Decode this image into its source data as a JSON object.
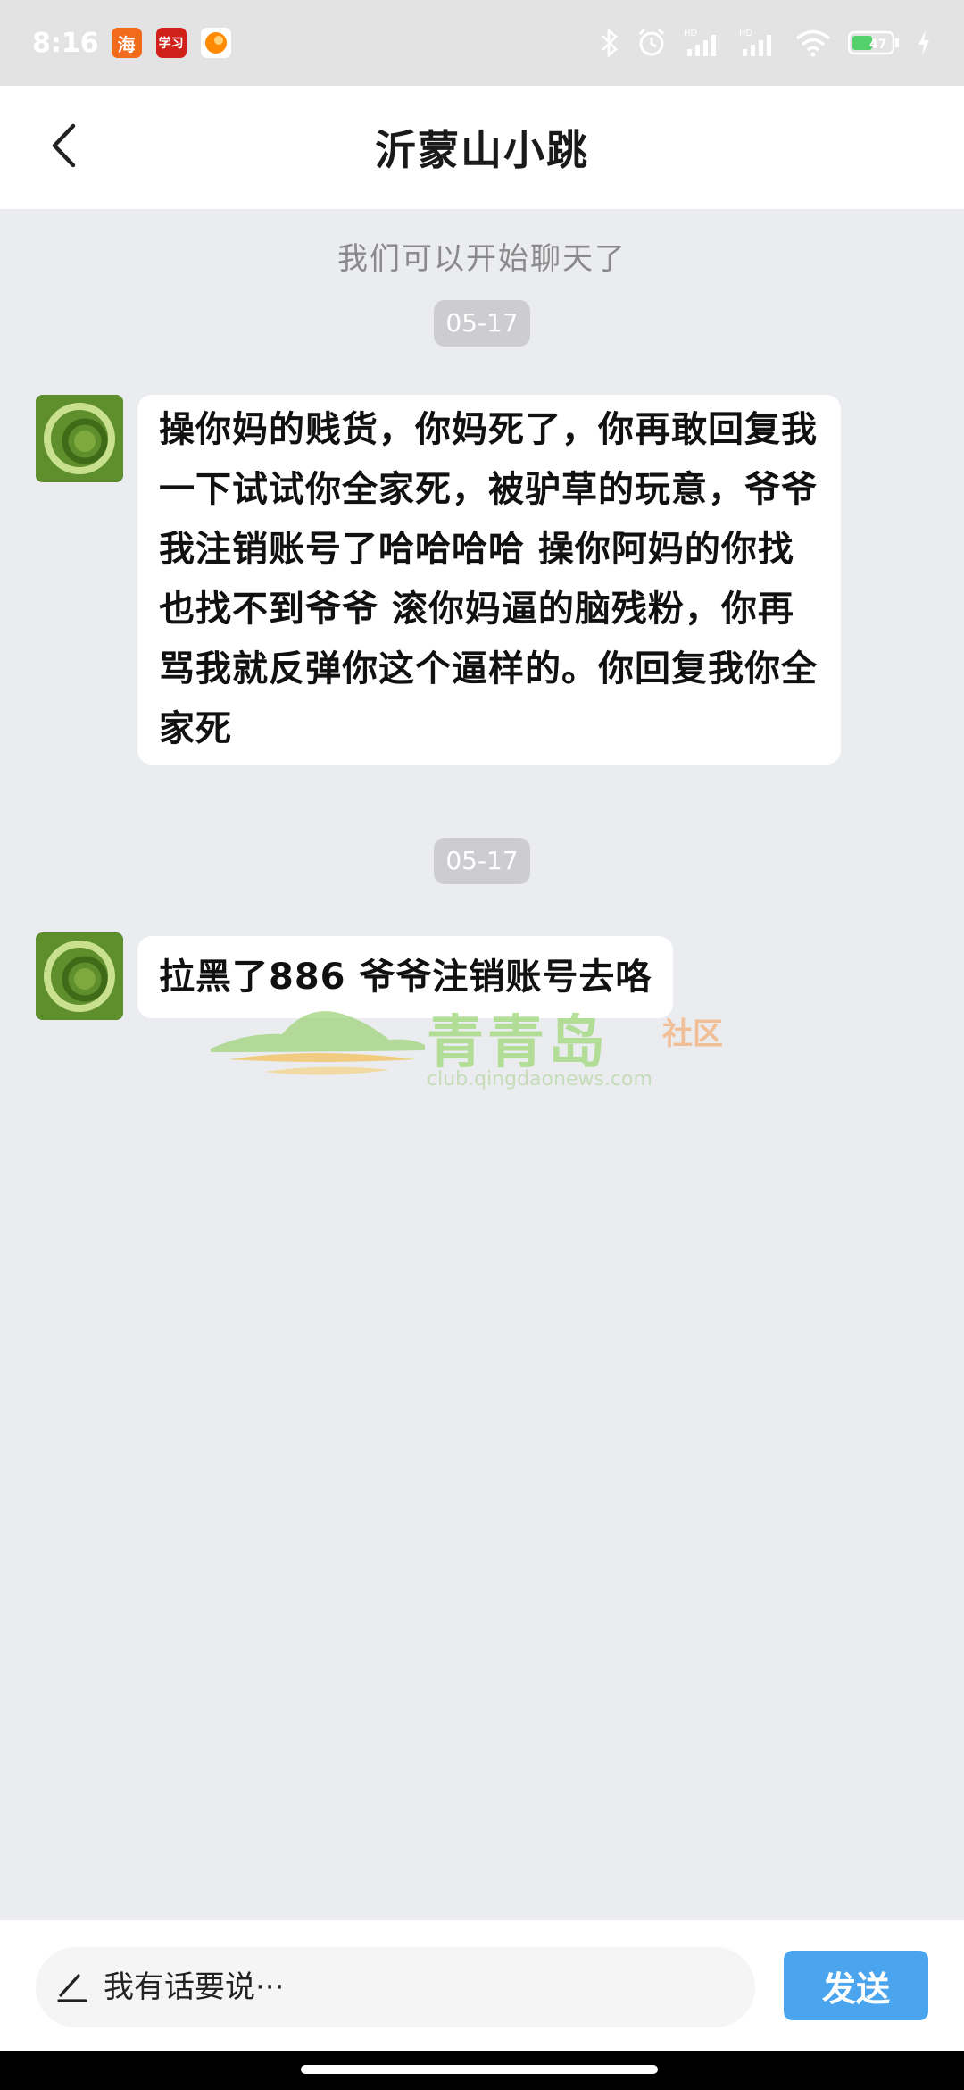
{
  "status_bar": {
    "time": "8:16",
    "apps": [
      {
        "name": "haishang-icon",
        "glyph": "海",
        "color": "#f26b1d"
      },
      {
        "name": "xuexi-icon",
        "glyph": "学习",
        "color": "#d0201a"
      },
      {
        "name": "orange-app-icon",
        "glyph": "",
        "color": "#ff8a00"
      }
    ],
    "battery": "47"
  },
  "header": {
    "title": "沂蒙山小跳"
  },
  "chat": {
    "system_note": "我们可以开始聊天了",
    "messages": [
      {
        "date": "05-17",
        "text": "操你妈的贱货，你妈死了，你再敢回复我一下试试你全家死，被驴草的玩意，爷爷我注销账号了哈哈哈哈 操你阿妈的你找也找不到爷爷 滚你妈逼的脑残粉，你再骂我就反弹你这个逼样的。你回复我你全家死"
      },
      {
        "date": "05-17",
        "text": "拉黑了886 爷爷注销账号去咯"
      }
    ]
  },
  "watermark": {
    "name": "青青岛",
    "sub": "社区",
    "url": "club.qingdaonews.com"
  },
  "input": {
    "placeholder": "我有话要说···",
    "send_label": "发送"
  },
  "colors": {
    "background": "#ebecef",
    "send_button": "#4aa5ee",
    "date_pill": "#cdcdd1"
  }
}
